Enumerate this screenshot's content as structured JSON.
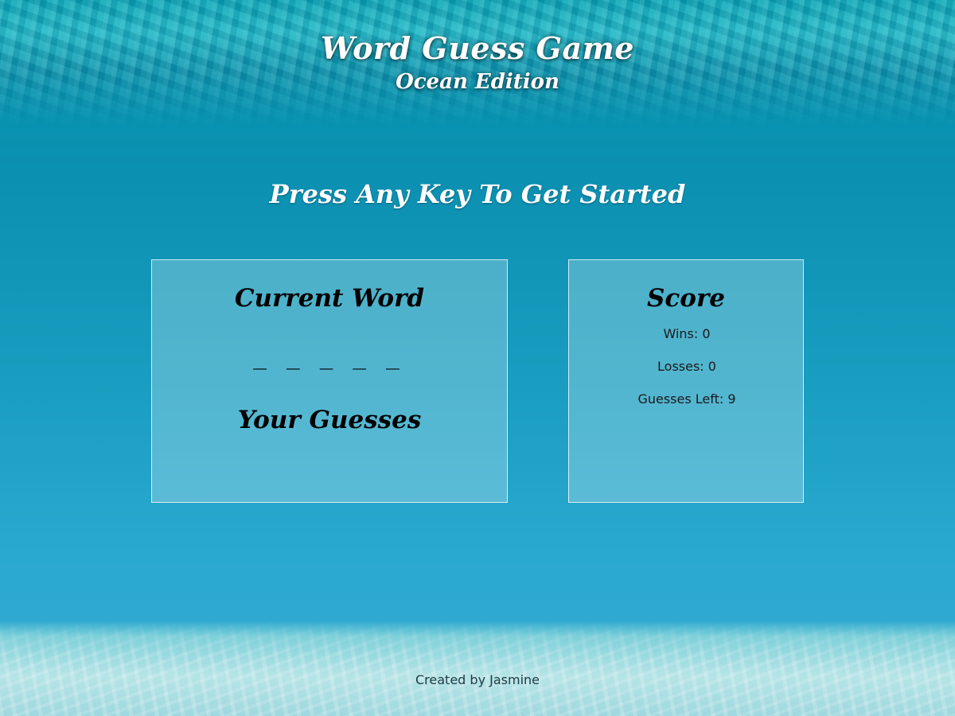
{
  "header": {
    "title": "Word Guess Game",
    "subtitle": "Ocean Edition"
  },
  "prompt": "Press Any Key To Get Started",
  "word_panel": {
    "heading": "Current Word",
    "blanks": "_ _ _ _ _",
    "guesses_heading": "Your Guesses",
    "guessed_letters": ""
  },
  "score_panel": {
    "heading": "Score",
    "wins": "Wins: 0",
    "losses": "Losses: 0",
    "guesses_left": "Guesses Left: 9"
  },
  "footer": "Created by Jasmine",
  "colors": {
    "water_top": "#0893b1",
    "water_bottom": "#2fa9d0",
    "panel_border": "#ffffff",
    "title_text": "#ffffff"
  }
}
